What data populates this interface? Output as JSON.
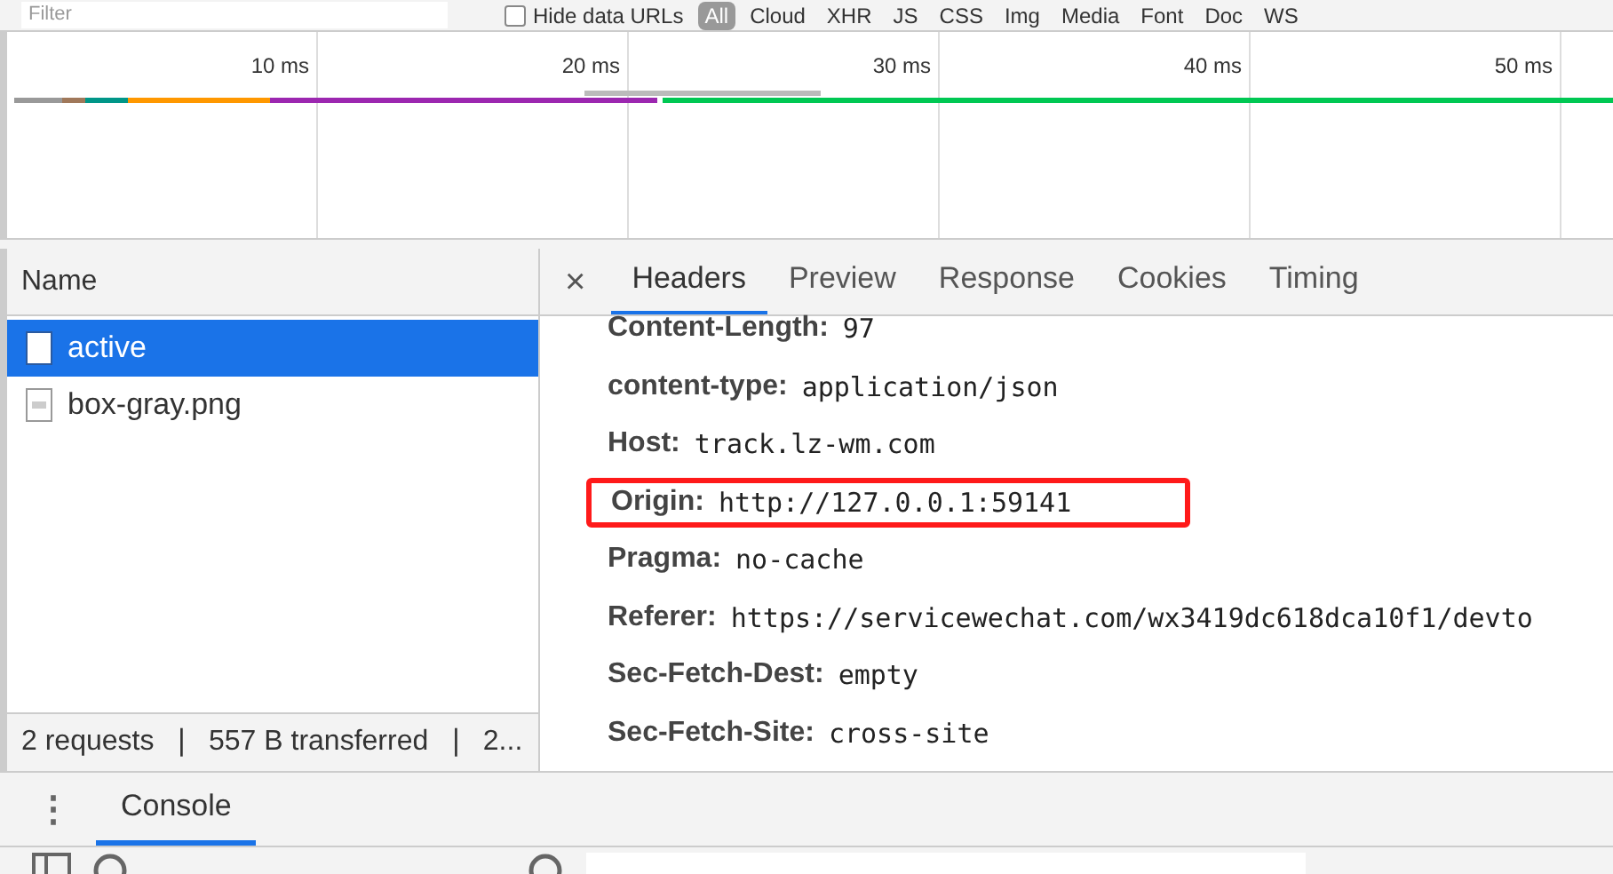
{
  "toolbar": {
    "filter_placeholder": "Filter",
    "hide_data_urls": {
      "label": "Hide data URLs",
      "checked": false
    },
    "type_filters": [
      {
        "label": "All",
        "selected": true
      },
      {
        "label": "Cloud",
        "selected": false
      },
      {
        "label": "XHR",
        "selected": false
      },
      {
        "label": "JS",
        "selected": false
      },
      {
        "label": "CSS",
        "selected": false
      },
      {
        "label": "Img",
        "selected": false
      },
      {
        "label": "Media",
        "selected": false
      },
      {
        "label": "Font",
        "selected": false
      },
      {
        "label": "Doc",
        "selected": false
      },
      {
        "label": "WS",
        "selected": false
      }
    ]
  },
  "timeline": {
    "ticks": [
      "10 ms",
      "20 ms",
      "30 ms",
      "40 ms",
      "50 ms"
    ]
  },
  "requests": {
    "column": "Name",
    "items": [
      {
        "name": "active",
        "kind": "document",
        "selected": true
      },
      {
        "name": "box-gray.png",
        "kind": "image",
        "selected": false
      }
    ],
    "status": "2 requests  ❘  557 B transferred  ❘  2..."
  },
  "details": {
    "close": "×",
    "tabs": [
      {
        "label": "Headers",
        "selected": true
      },
      {
        "label": "Preview",
        "selected": false
      },
      {
        "label": "Response",
        "selected": false
      },
      {
        "label": "Cookies",
        "selected": false
      },
      {
        "label": "Timing",
        "selected": false
      }
    ],
    "headers": [
      {
        "name": "Content-Length:",
        "value": "97",
        "highlighted": false
      },
      {
        "name": "content-type:",
        "value": "application/json",
        "highlighted": false
      },
      {
        "name": "Host:",
        "value": "track.lz-wm.com",
        "highlighted": false
      },
      {
        "name": "Origin:",
        "value": "http://127.0.0.1:59141",
        "highlighted": true
      },
      {
        "name": "Pragma:",
        "value": "no-cache",
        "highlighted": false
      },
      {
        "name": "Referer:",
        "value": "https://servicewechat.com/wx3419dc618dca10f1/devto",
        "highlighted": false
      },
      {
        "name": "Sec-Fetch-Dest:",
        "value": "empty",
        "highlighted": false
      },
      {
        "name": "Sec-Fetch-Site:",
        "value": "cross-site",
        "highlighted": false
      }
    ]
  },
  "drawer": {
    "menu": "⋮",
    "tabs": [
      {
        "label": "Console",
        "selected": true
      }
    ]
  }
}
